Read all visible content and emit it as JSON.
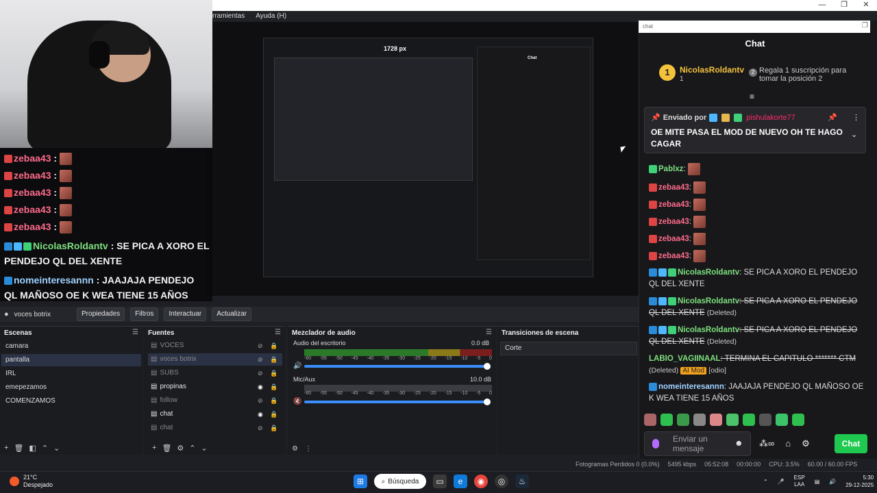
{
  "window": {
    "minimize": "—",
    "maximize": "❐",
    "close": "✕"
  },
  "menu": [
    "rramientas",
    "Ayuda (H)"
  ],
  "preview": {
    "width_label": "1728 px",
    "nested_chat_title": "Chat"
  },
  "overlay_chat": [
    {
      "user": "zebaa43",
      "sep": " :"
    },
    {
      "user": "zebaa43",
      "sep": " :"
    },
    {
      "user": "zebaa43",
      "sep": " :"
    },
    {
      "user": "zebaa43",
      "sep": " :"
    },
    {
      "user": "zebaa43",
      "sep": " :"
    },
    {
      "user": "NicolasRoldantv",
      "msg": " : SE PICA A XORO EL PENDEJO QL DEL XENTE"
    },
    {
      "user": "nomeinteresannn",
      "msg": " : JAAJAJA PENDEJO QL MAÑOSO OE K WEA TIENE 15 AÑOS"
    }
  ],
  "source_toolbar": {
    "source_name": "voces botrix",
    "buttons": [
      "Propiedades",
      "Filtros",
      "Interactuar",
      "Actualizar"
    ]
  },
  "scenes": {
    "title": "Escenas",
    "items": [
      "camara",
      "pantalla",
      "IRL",
      "emepezamos",
      "COMENZAMOS"
    ],
    "selected": 1
  },
  "sources": {
    "title": "Fuentes",
    "items": [
      {
        "name": "VOCES",
        "visible": false
      },
      {
        "name": "voces botrix",
        "visible": false
      },
      {
        "name": "SUBS",
        "visible": false
      },
      {
        "name": "propinas",
        "visible": true
      },
      {
        "name": "follow",
        "visible": false
      },
      {
        "name": "chat",
        "visible": true
      },
      {
        "name": "chat",
        "visible": false
      }
    ]
  },
  "audio": {
    "title": "Mezclador de audio",
    "channels": [
      {
        "name": "Audio del escritorio",
        "db": "0.0 dB",
        "level": 0.99
      },
      {
        "name": "Mic/Aux",
        "db": "10.0 dB",
        "level": 0.99
      }
    ],
    "scale": [
      "-60",
      "-55",
      "-50",
      "-45",
      "-40",
      "-35",
      "-30",
      "-25",
      "-20",
      "-15",
      "-10",
      "-5",
      "0"
    ]
  },
  "transitions": {
    "title": "Transiciones de escena",
    "current": "Corte"
  },
  "statusbar": {
    "frames": "Fotogramas Perdidos 0 (0.0%)",
    "kbps": "5495 kbps",
    "time": "05:52:08",
    "rec": "00:00:00",
    "cpu": "CPU: 3.5%",
    "fps": "60.00 / 60.00 FPS"
  },
  "chat": {
    "url_placeholder": "chat",
    "title": "Chat",
    "leader": {
      "rank": "1",
      "name": "NicolasRoldantv",
      "count": "1"
    },
    "second": {
      "rank": "2",
      "text": "Regala 1 suscripción para tomar la posición 2"
    },
    "pinned": {
      "label": "Enviado por",
      "user": "pishulakorte77",
      "message": "OE MITE PASA EL MOD DE NUEVO OH TE HAGO CAGAR"
    },
    "messages": [
      {
        "user": "Pablxz",
        "text": ":",
        "kind": "g"
      },
      {
        "user": "zebaa43",
        "text": ":",
        "kind": "z"
      },
      {
        "user": "zebaa43",
        "text": ":",
        "kind": "z"
      },
      {
        "user": "zebaa43",
        "text": ":",
        "kind": "z"
      },
      {
        "user": "zebaa43",
        "text": ":",
        "kind": "z"
      },
      {
        "user": "zebaa43",
        "text": ":",
        "kind": "z"
      },
      {
        "user": "NicolasRoldantv",
        "text": ": SE PICA A XORO EL PENDEJO QL DEL XENTE",
        "kind": "g"
      },
      {
        "user": "NicolasRoldantv",
        "text": ": SE PICA A XORO EL PENDEJO QL DEL XENTE",
        "kind": "g",
        "deleted": "(Deleted)"
      },
      {
        "user": "NicolasRoldantv",
        "text": ": SE PICA A XORO EL PENDEJO QL DEL XENTE",
        "kind": "g",
        "deleted": "(Deleted)"
      },
      {
        "user": "LABIO_VAGIINAAL",
        "text": ": TERMINA EL CAPITULO ******* CTM",
        "kind": "g",
        "deleted": "(Deleted)",
        "mod": "AI Mod",
        "tag": "[odio]"
      },
      {
        "user": "nomeinteresannn",
        "text": ": JAAJAJA PENDEJO QL MAÑOSO OE K WEA TIENE 15 AÑOS",
        "kind": "b"
      }
    ],
    "input_placeholder": "Enviar un mensaje",
    "send_label": "Chat"
  },
  "taskbar": {
    "temp": "21°C",
    "weather": "Despejado",
    "search": "Búsqueda",
    "lang": "ESP",
    "lang2": "LAA",
    "time": "5:30",
    "date": "29-12-2025"
  },
  "colors": {
    "accent_green": "#1fc94f",
    "pin_user": "#ff2a66",
    "leader_gold": "#f5c33b"
  }
}
